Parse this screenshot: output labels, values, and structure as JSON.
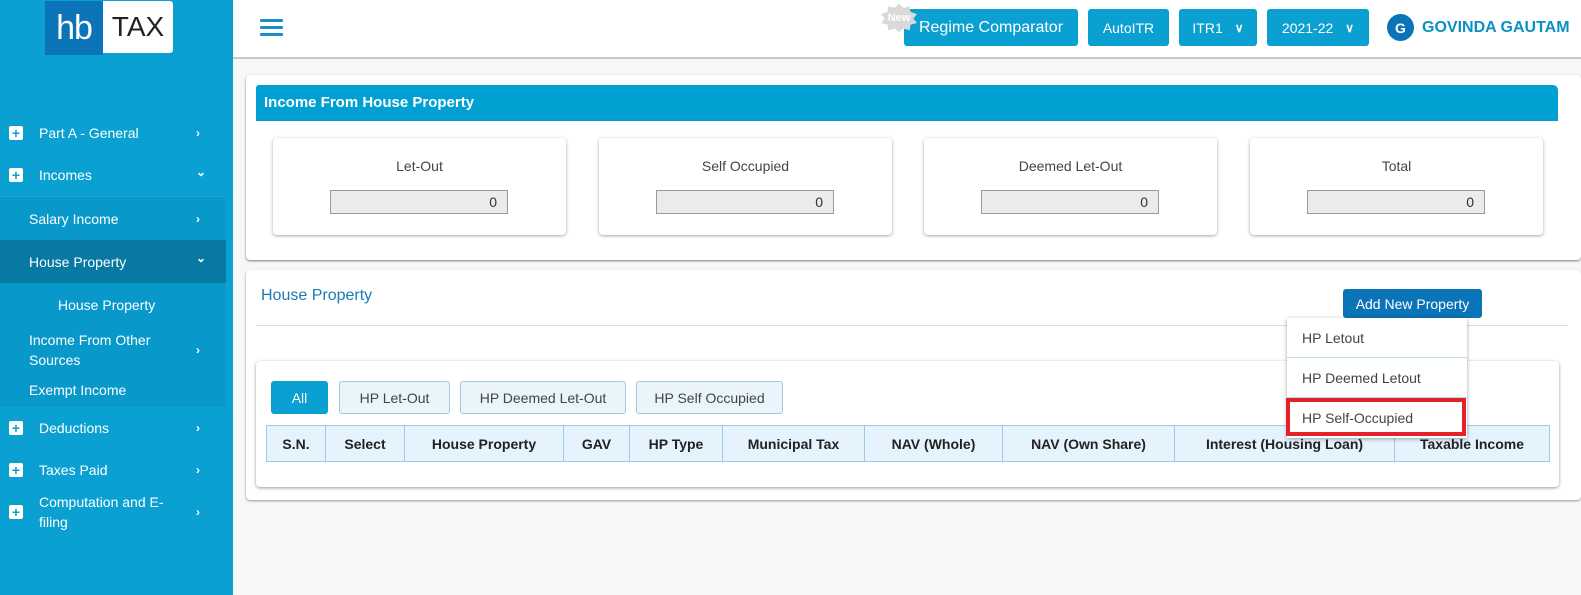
{
  "logo": {
    "left": "hb",
    "right": "TAX"
  },
  "sidebar": {
    "items": [
      {
        "label": "Part A - General",
        "icon": "plus-square-icon",
        "chevron": "›"
      },
      {
        "label": "Incomes",
        "icon": "plus-square-icon",
        "chevron": "⌄"
      }
    ],
    "incomes_sub": [
      {
        "label": "Salary Income",
        "chevron": "›"
      },
      {
        "label": "House Property",
        "chevron": "⌄",
        "active": true
      },
      {
        "label": "House Property"
      },
      {
        "label": "Income From Other Sources",
        "chevron": "›"
      },
      {
        "label": "Exempt Income"
      }
    ],
    "bottom_items": [
      {
        "label": "Deductions",
        "icon": "plus-square-icon",
        "chevron": "›"
      },
      {
        "label": "Taxes Paid",
        "icon": "plus-square-icon",
        "chevron": "›"
      },
      {
        "label": "Computation and E-filing",
        "icon": "plus-square-icon",
        "chevron": "›"
      }
    ]
  },
  "topbar": {
    "menu_icon": "hamburger-icon",
    "new_badge": "New",
    "regime_comparator": "Regime Comparator",
    "auto_itr": "AutoITR",
    "itr_select": "ITR1",
    "year_select": "2021-22",
    "user_initial": "G",
    "user_name": "GOVINDA GAUTAM"
  },
  "income_summary": {
    "title": "Income From House Property",
    "boxes": [
      {
        "label": "Let-Out",
        "value": "0"
      },
      {
        "label": "Self Occupied",
        "value": "0"
      },
      {
        "label": "Deemed Let-Out",
        "value": "0"
      },
      {
        "label": "Total",
        "value": "0"
      }
    ]
  },
  "house_property": {
    "title": "House Property",
    "add_button": "Add New Property",
    "dropdown": [
      "HP Letout",
      "HP Deemed Letout",
      "HP Self-Occupied"
    ],
    "highlighted_option": "HP Self-Occupied",
    "filters": [
      "All",
      "HP Let-Out",
      "HP Deemed Let-Out",
      "HP Self Occupied"
    ],
    "active_filter": "All",
    "columns": [
      "S.N.",
      "Select",
      "House Property",
      "GAV",
      "HP Type",
      "Municipal Tax",
      "NAV (Whole)",
      "NAV (Own Share)",
      "Interest (Housing Loan)",
      "Taxable Income"
    ],
    "rows": []
  },
  "colors": {
    "sidebar": "#0aa0d2",
    "sidebar_active": "#0779a2",
    "brand_dark": "#0b73b8",
    "header_bar": "#00a0d2",
    "highlight": "#e3212b"
  }
}
